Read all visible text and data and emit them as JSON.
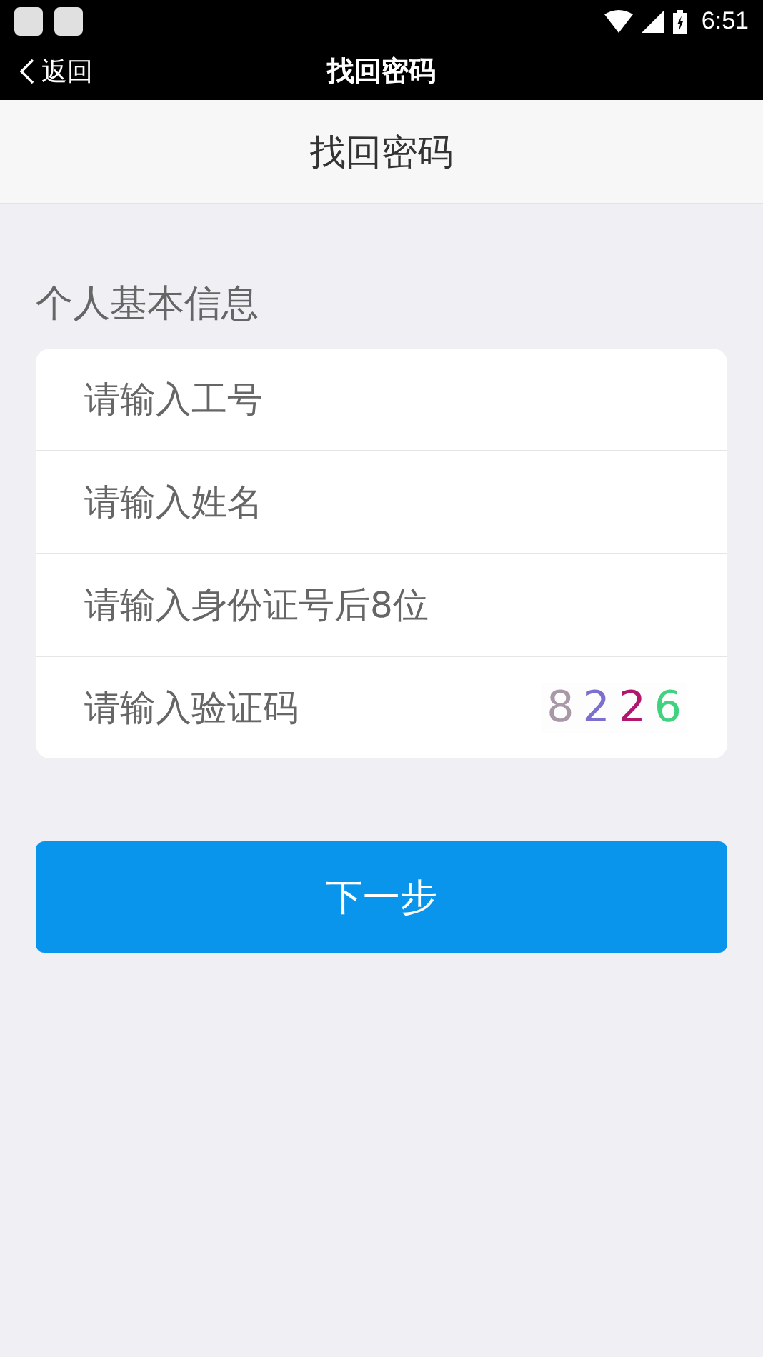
{
  "status_bar": {
    "time": "6:51"
  },
  "nav_bar": {
    "back": "返回",
    "title": "找回密码"
  },
  "header": {
    "title": "找回密码"
  },
  "section": {
    "label": "个人基本信息"
  },
  "fields": [
    {
      "kind": "text",
      "placeholder": "请输入工号"
    },
    {
      "kind": "text",
      "placeholder": "请输入姓名"
    },
    {
      "kind": "text",
      "placeholder": "请输入身份证号后8位"
    },
    {
      "kind": "captcha",
      "placeholder": "请输入验证码",
      "captcha": [
        {
          "char": "8",
          "color": "#a898a8"
        },
        {
          "char": "2",
          "color": "#7b6fcf"
        },
        {
          "char": "2",
          "color": "#b3166e"
        },
        {
          "char": "6",
          "color": "#3fd27f"
        }
      ]
    }
  ],
  "next_button": "下一步"
}
